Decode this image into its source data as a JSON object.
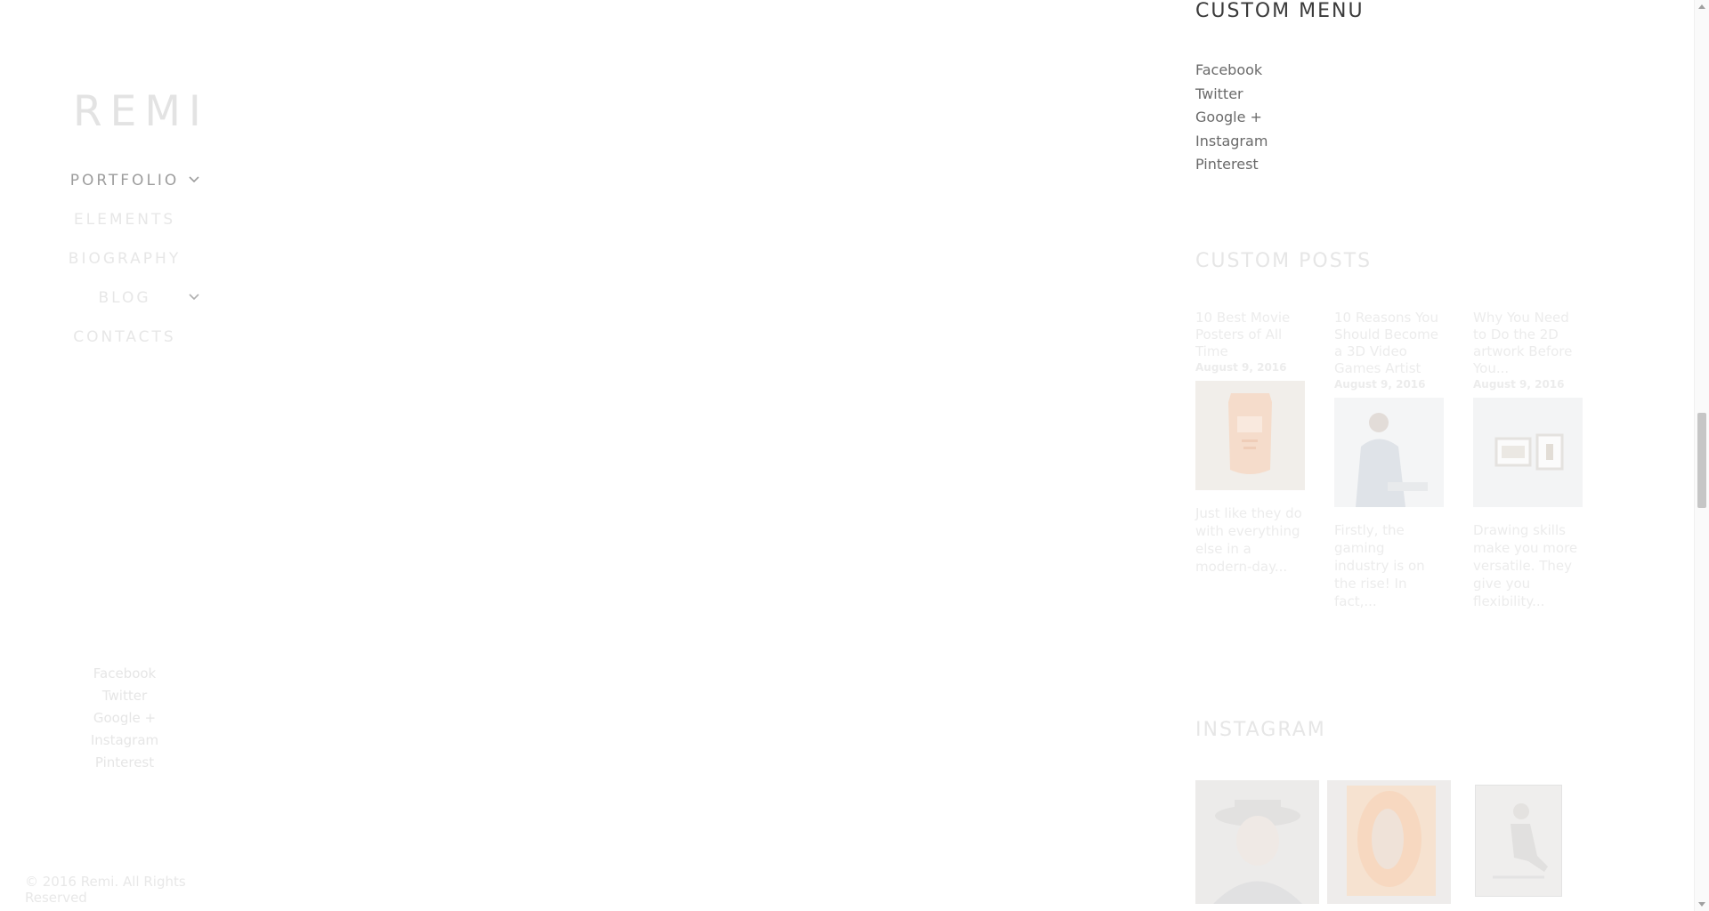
{
  "sidebar": {
    "logo": "REMI",
    "nav": [
      {
        "label": "PORTFOLIO",
        "has_submenu": true
      },
      {
        "label": "ELEMENTS",
        "has_submenu": false
      },
      {
        "label": "BIOGRAPHY",
        "has_submenu": false
      },
      {
        "label": "BLOG",
        "has_submenu": true
      },
      {
        "label": "CONTACTS",
        "has_submenu": false
      }
    ],
    "social": [
      "Facebook",
      "Twitter",
      "Google +",
      "Instagram",
      "Pinterest"
    ],
    "copyright": "© 2016 Remi. All Rights Reserved"
  },
  "widgets": {
    "custom_menu": {
      "title": "CUSTOM MENU",
      "items": [
        "Facebook",
        "Twitter",
        "Google +",
        "Instagram",
        "Pinterest"
      ]
    },
    "custom_posts": {
      "title": "CUSTOM POSTS",
      "posts": [
        {
          "title": "10 Best Movie Posters of All Time",
          "date": "August 9, 2016",
          "excerpt": "Just like they do with everything else in a modern-day...",
          "thumb_icon": "product-bag-image"
        },
        {
          "title": "10 Reasons You Should Become a 3D Video Games Artist",
          "date": "August 9, 2016",
          "excerpt": "Firstly, the gaming industry is on the rise! In fact,...",
          "thumb_icon": "man-portrait-image"
        },
        {
          "title": "Why You Need to Do the 2D artwork Before You...",
          "date": "August 9, 2016",
          "excerpt": "Drawing skills make you more versatile. They give you flexibility...",
          "thumb_icon": "framed-art-image"
        }
      ]
    },
    "instagram": {
      "title": "INSTAGRAM",
      "images": [
        "man-in-hat-image",
        "ear-sculpture-image",
        "seated-woman-image"
      ]
    }
  },
  "colors": {
    "background": "#ffffff",
    "menu_title": "#3a3a3a",
    "menu_link": "#6a6a6a",
    "faded_text": "#e6e6e6",
    "scroll_thumb": "#c6c6c6"
  }
}
